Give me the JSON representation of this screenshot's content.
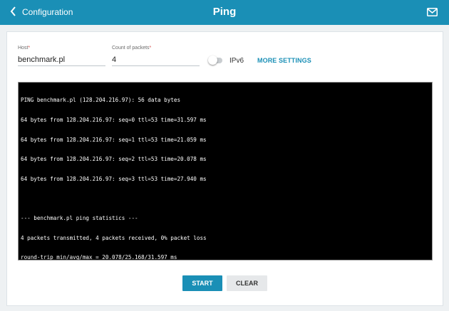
{
  "header": {
    "back_label": "Configuration",
    "title": "Ping",
    "accent_color": "#1a8fb6"
  },
  "form": {
    "host": {
      "label": "Host",
      "required_mark": "*",
      "value": "benchmark.pl"
    },
    "count": {
      "label": "Count of packets",
      "required_mark": "*",
      "value": "4"
    },
    "ipv6": {
      "label": "IPv6",
      "enabled": false
    },
    "more_settings_label": "MORE SETTINGS"
  },
  "console": {
    "lines": [
      "PING benchmark.pl (128.204.216.97): 56 data bytes",
      "64 bytes from 128.204.216.97: seq=0 ttl=53 time=31.597 ms",
      "64 bytes from 128.204.216.97: seq=1 ttl=53 time=21.059 ms",
      "64 bytes from 128.204.216.97: seq=2 ttl=53 time=20.078 ms",
      "64 bytes from 128.204.216.97: seq=3 ttl=53 time=27.940 ms",
      "",
      "--- benchmark.pl ping statistics ---",
      "4 packets transmitted, 4 packets received, 0% packet loss",
      "round-trip min/avg/max = 20.078/25.168/31.597 ms"
    ]
  },
  "actions": {
    "start_label": "START",
    "clear_label": "CLEAR"
  }
}
